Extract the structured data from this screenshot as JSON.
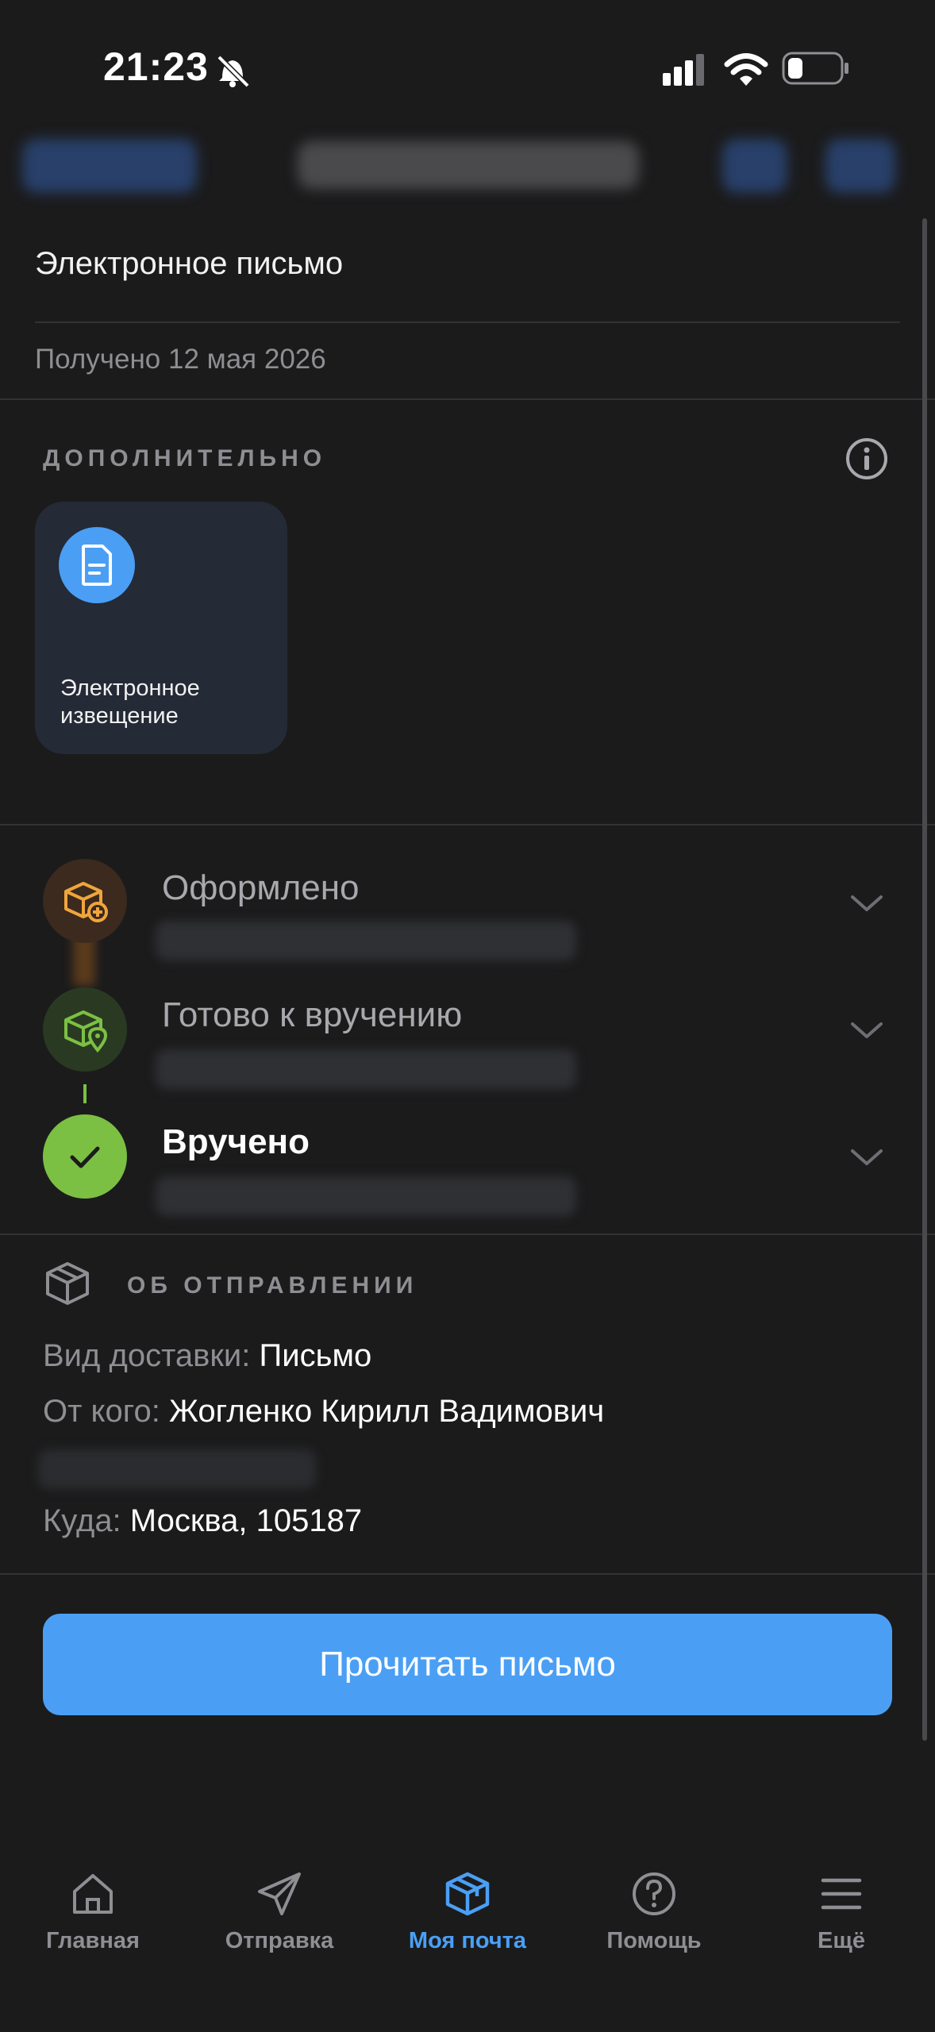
{
  "status_bar": {
    "time": "21:23"
  },
  "letter": {
    "title": "Электронное  письмо",
    "received": "Получено 12 мая 2026"
  },
  "extra": {
    "heading": "ДОПОЛНИТЕЛЬНО",
    "card_label": "Электронное извещение"
  },
  "timeline": [
    {
      "label": "Оформлено",
      "icon": "box-plus-icon",
      "color": "#f0a53c"
    },
    {
      "label": "Готово к вручению",
      "icon": "box-pin-icon",
      "color": "#7bc043"
    },
    {
      "label": "Вручено",
      "icon": "check-icon",
      "color": "#7bc043"
    }
  ],
  "shipment": {
    "heading": "ОБ ОТПРАВЛЕНИИ",
    "delivery_key": "Вид доставки:",
    "delivery_val": "Письмо",
    "from_key": "От кого:",
    "from_val": "Жогленко Кирилл Вадимович",
    "to_key": "Куда:",
    "to_val": "Москва, 105187"
  },
  "cta": {
    "label": "Прочитать письмо"
  },
  "tabbar": [
    {
      "label": "Главная",
      "icon": "home-icon",
      "active": false
    },
    {
      "label": "Отправка",
      "icon": "send-icon",
      "active": false
    },
    {
      "label": "Моя почта",
      "icon": "box-icon",
      "active": true
    },
    {
      "label": "Помощь",
      "icon": "help-icon",
      "active": false
    },
    {
      "label": "Ещё",
      "icon": "menu-icon",
      "active": false
    }
  ],
  "colors": {
    "accent": "#4a9ff5",
    "success": "#7bc043",
    "warning": "#f0a53c",
    "background": "#1b1b1c"
  }
}
